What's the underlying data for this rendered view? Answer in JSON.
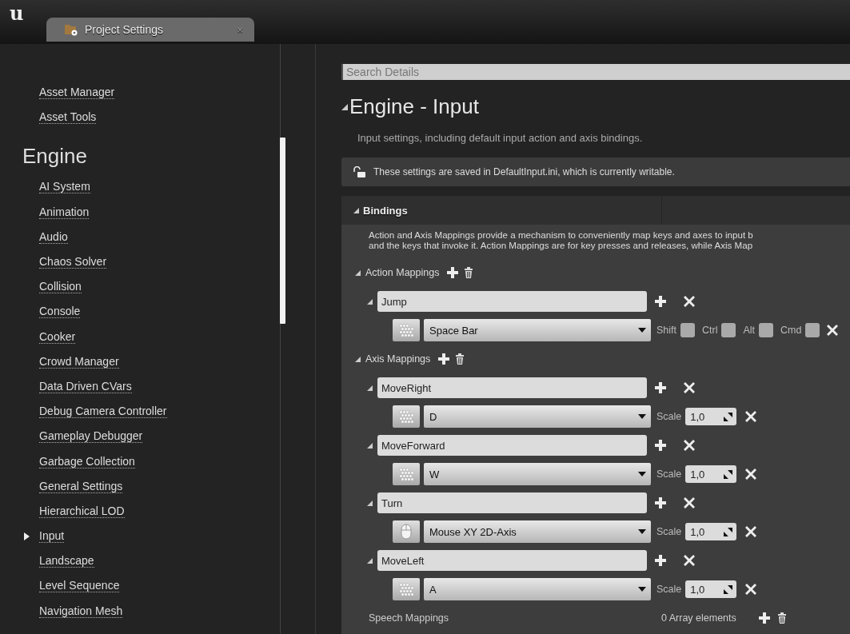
{
  "logo": "u",
  "tabs": [
    {
      "label": "Project Settings",
      "selected": true,
      "close": "×"
    }
  ],
  "sidebar": {
    "sections": [
      {
        "items": [
          {
            "label": "Asset Manager",
            "selected": false
          },
          {
            "label": "Asset Tools",
            "selected": false
          }
        ]
      },
      {
        "title": "Engine",
        "items": [
          {
            "label": "AI System",
            "selected": false
          },
          {
            "label": "Animation",
            "selected": false
          },
          {
            "label": "Audio",
            "selected": false
          },
          {
            "label": "Chaos Solver",
            "selected": false
          },
          {
            "label": "Collision",
            "selected": false
          },
          {
            "label": "Console",
            "selected": false
          },
          {
            "label": "Cooker",
            "selected": false
          },
          {
            "label": "Crowd Manager",
            "selected": false
          },
          {
            "label": "Data Driven CVars",
            "selected": false
          },
          {
            "label": "Debug Camera Controller",
            "selected": false
          },
          {
            "label": "Gameplay Debugger",
            "selected": false
          },
          {
            "label": "Garbage Collection",
            "selected": false
          },
          {
            "label": "General Settings",
            "selected": false
          },
          {
            "label": "Hierarchical LOD",
            "selected": false
          },
          {
            "label": "Input",
            "selected": true
          },
          {
            "label": "Landscape",
            "selected": false
          },
          {
            "label": "Level Sequence",
            "selected": false
          },
          {
            "label": "Navigation Mesh",
            "selected": false
          }
        ]
      }
    ]
  },
  "search": {
    "placeholder": "Search Details"
  },
  "heading": {
    "title": "Engine - Input",
    "expanded": true,
    "description": "Input settings, including default input action and axis bindings."
  },
  "notice": {
    "text": "These settings are saved in DefaultInput.ini, which is currently writable.",
    "locked": false
  },
  "bindings": {
    "title": "Bindings",
    "expanded": true,
    "description": [
      "Action and Axis Mappings provide a mechanism to conveniently map keys and axes to input b",
      "and the keys that invoke it. Action Mappings are for key presses and releases, while Axis Map"
    ],
    "groups": [
      {
        "label": "Action Mappings",
        "expanded": true,
        "kind": "action",
        "items": [
          {
            "name": "Jump",
            "expanded": true,
            "keys": [
              {
                "kind": "keyboard",
                "key": "Space Bar",
                "modifiers": [
                  {
                    "label": "Shift",
                    "checked": false
                  },
                  {
                    "label": "Ctrl",
                    "checked": false
                  },
                  {
                    "label": "Alt",
                    "checked": false
                  },
                  {
                    "label": "Cmd",
                    "checked": false
                  }
                ]
              }
            ]
          }
        ]
      },
      {
        "label": "Axis Mappings",
        "expanded": true,
        "kind": "axis",
        "items": [
          {
            "name": "MoveRight",
            "expanded": true,
            "keys": [
              {
                "kind": "keyboard",
                "key": "D",
                "scale_label": "Scale",
                "scale": "1,0"
              }
            ]
          },
          {
            "name": "MoveForward",
            "expanded": true,
            "keys": [
              {
                "kind": "keyboard",
                "key": "W",
                "scale_label": "Scale",
                "scale": "1,0"
              }
            ]
          },
          {
            "name": "Turn",
            "expanded": true,
            "keys": [
              {
                "kind": "mouse",
                "key": "Mouse XY 2D-Axis",
                "scale_label": "Scale",
                "scale": "1,0"
              }
            ]
          },
          {
            "name": "MoveLeft",
            "expanded": true,
            "keys": [
              {
                "kind": "keyboard",
                "key": "A",
                "scale_label": "Scale",
                "scale": "1,0"
              }
            ]
          }
        ]
      }
    ],
    "speech": {
      "label": "Speech Mappings",
      "value": "0 Array elements"
    }
  }
}
